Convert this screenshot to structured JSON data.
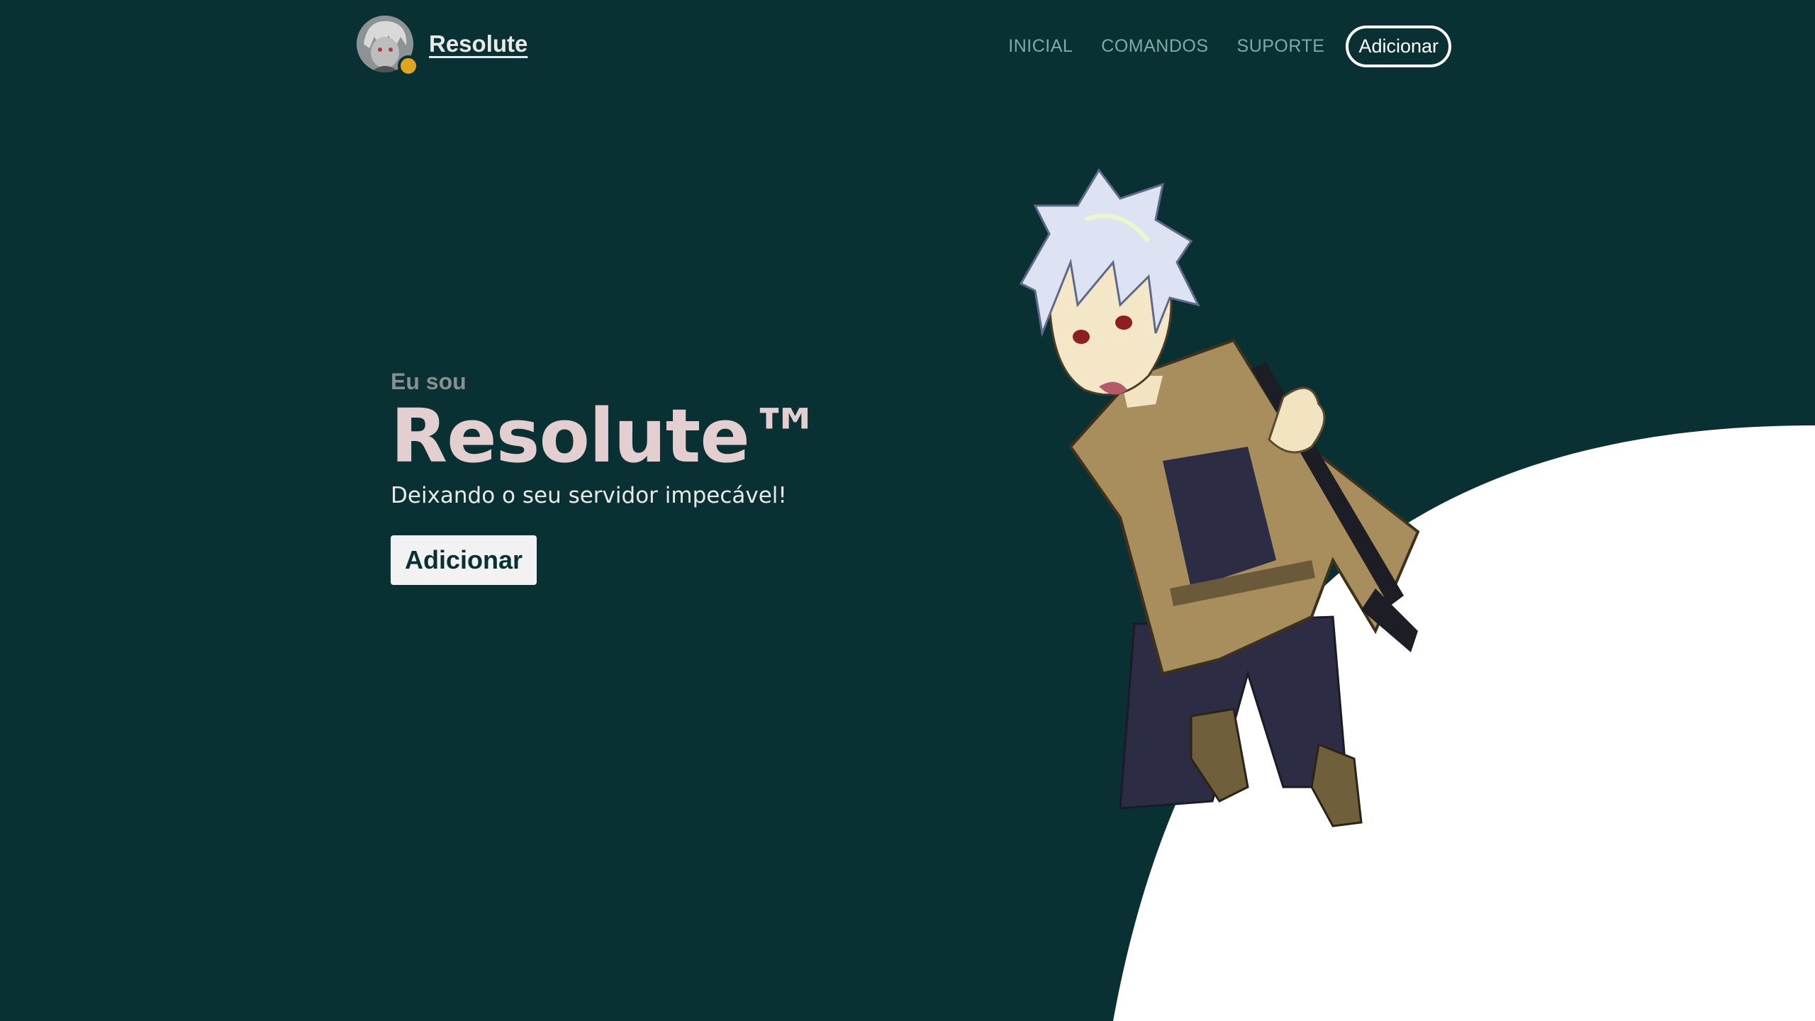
{
  "colors": {
    "background": "#093133",
    "curve": "#ffffff",
    "status_dot": "#e0a520",
    "title": "#e3cfcf",
    "nav_link": "#7eaaa8"
  },
  "brand": {
    "name": "Resolute",
    "avatar_icon": "avatar-icon"
  },
  "nav": {
    "links": [
      "INICIAL",
      "COMANDOS",
      "SUPORTE"
    ],
    "cta": "Adicionar"
  },
  "hero": {
    "eyebrow": "Eu sou",
    "title": "Resolute™",
    "subtitle": "Deixando o seu servidor impecável!",
    "button": "Adicionar"
  }
}
